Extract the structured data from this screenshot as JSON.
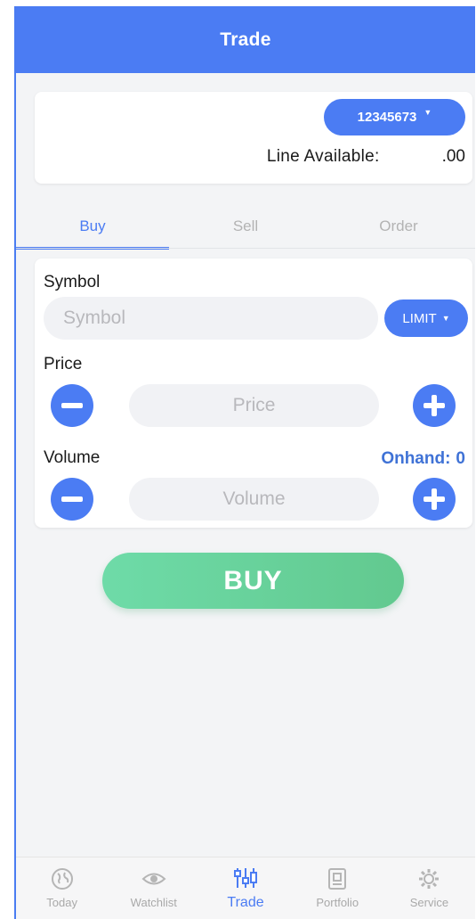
{
  "header": {
    "title": "Trade"
  },
  "account": {
    "number": "12345673",
    "line_label": "Line  Available:",
    "line_value": ".00"
  },
  "tabs": [
    {
      "label": "Buy",
      "active": true
    },
    {
      "label": "Sell",
      "active": false
    },
    {
      "label": "Order",
      "active": false
    }
  ],
  "form": {
    "symbol_label": "Symbol",
    "symbol_placeholder": "Symbol",
    "order_type": "LIMIT",
    "price_label": "Price",
    "price_placeholder": "Price",
    "volume_label": "Volume",
    "volume_placeholder": "Volume",
    "onhand_label": "Onhand:",
    "onhand_value": "0"
  },
  "buy_button": {
    "label": "BUY"
  },
  "bottom_nav": [
    {
      "label": "Today",
      "icon": "globe-icon"
    },
    {
      "label": "Watchlist",
      "icon": "eye-icon"
    },
    {
      "label": "Trade",
      "icon": "sliders-icon",
      "active": true
    },
    {
      "label": "Portfolio",
      "icon": "portfolio-icon"
    },
    {
      "label": "Service",
      "icon": "gear-icon"
    }
  ],
  "colors": {
    "primary": "#4b7cf3",
    "buy_green": "#66d19b",
    "onhand_blue": "#3f72d6"
  }
}
